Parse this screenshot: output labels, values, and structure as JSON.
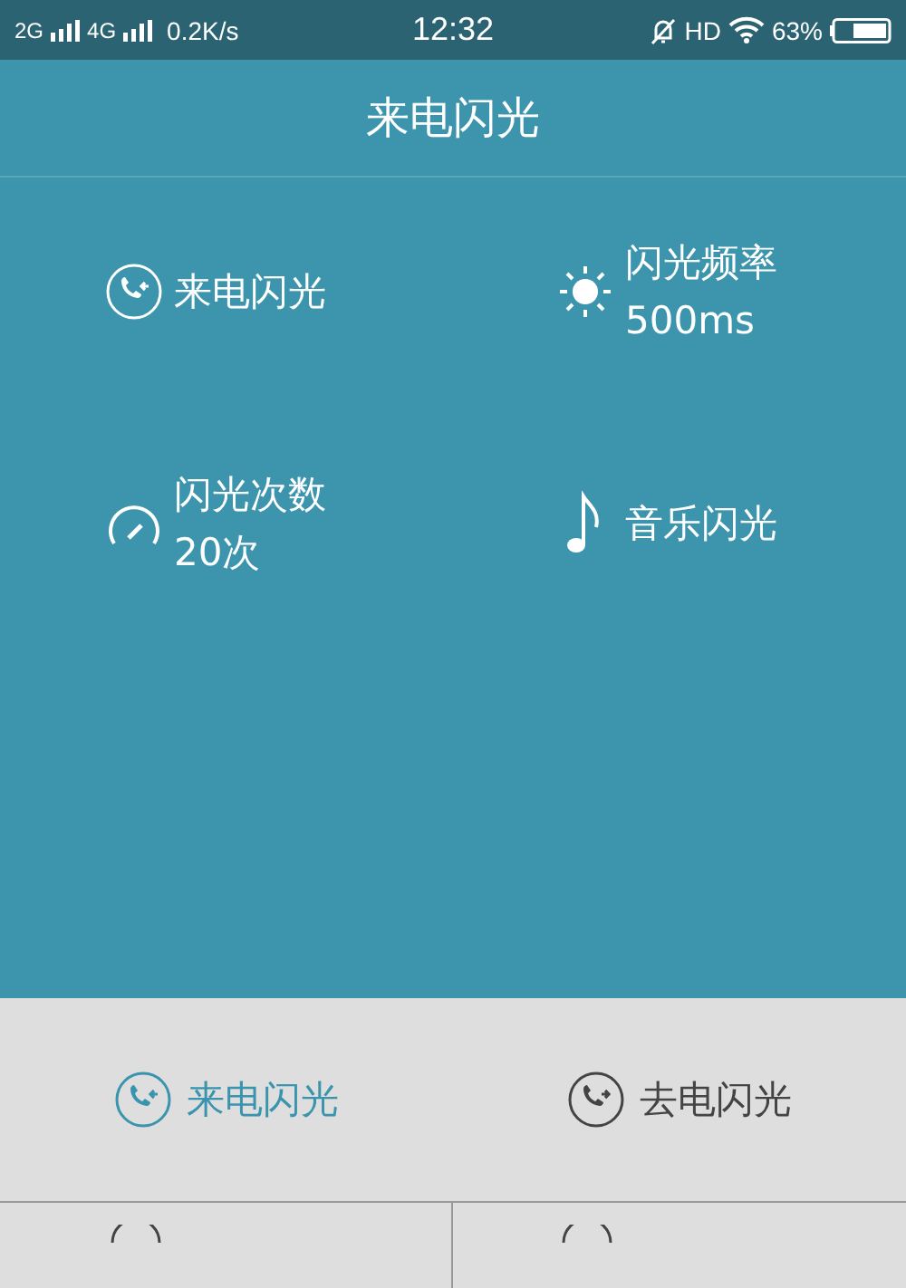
{
  "status_bar": {
    "left": [
      "2G",
      "4G",
      "0.2K/s"
    ],
    "time": "12:32",
    "hd": "HD",
    "battery": "63%"
  },
  "title": "来电闪光",
  "settings": [
    {
      "kind": "incoming",
      "label": "来电闪光"
    },
    {
      "kind": "brightness",
      "label": "闪光频率",
      "value": "500ms"
    },
    {
      "kind": "count",
      "label": "闪光次数",
      "value": "20次"
    },
    {
      "kind": "music",
      "label": "音乐闪光"
    }
  ],
  "modes": [
    {
      "kind": "incoming",
      "label": "来电闪光",
      "selected": true
    },
    {
      "kind": "outgoing",
      "label": "去电闪光",
      "selected": false
    }
  ]
}
